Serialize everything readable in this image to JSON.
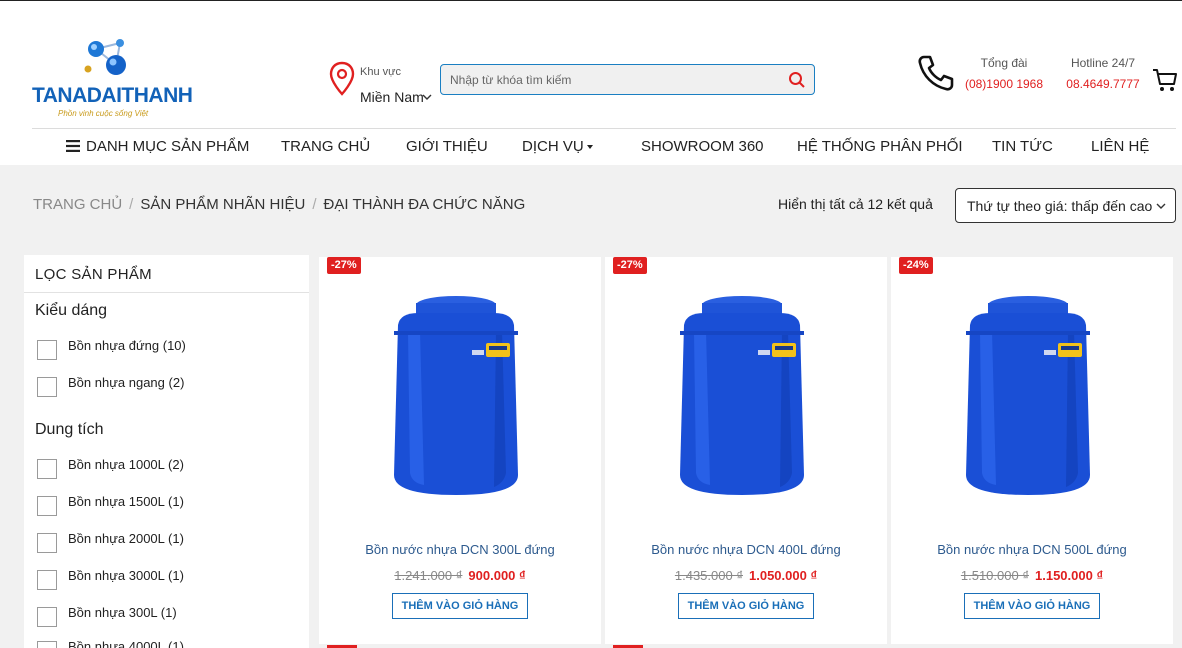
{
  "brand": {
    "name": "TANADAITHANH",
    "slogan": "Phồn vinh cuộc sống Việt",
    "blue": "#1262b8",
    "gold": "#c89a1a"
  },
  "region": {
    "label": "Khu vực",
    "value": "Miền Nam"
  },
  "search": {
    "placeholder": "Nhập từ khóa tìm kiếm"
  },
  "contacts": [
    {
      "label": "Tổng đài",
      "value": "(08)1900 1968"
    },
    {
      "label": "Hotline 24/7",
      "value": "08.4649.7777"
    }
  ],
  "nav": {
    "items": [
      "DANH MỤC SẢN PHẨM",
      "TRANG CHỦ",
      "GIỚI THIỆU",
      "DỊCH VỤ",
      "SHOWROOM 360",
      "HỆ THỐNG PHÂN PHỐI",
      "TIN TỨC",
      "LIÊN HỆ"
    ]
  },
  "breadcrumb": [
    "TRANG CHỦ",
    "SẢN PHẨM NHÃN HIỆU",
    "ĐẠI THÀNH ĐA CHỨC NĂNG"
  ],
  "results": {
    "count_text": "Hiển thị tất cả 12 kết quả",
    "sort_value": "Thứ tự theo giá: thấp đến cao"
  },
  "filters": {
    "title": "LỌC SẢN PHẨM",
    "groups": [
      {
        "heading": "Kiểu dáng",
        "options": [
          "Bồn nhựa đứng (10)",
          "Bồn nhựa ngang (2)"
        ]
      },
      {
        "heading": "Dung tích",
        "options": [
          "Bồn nhựa 1000L (2)",
          "Bồn nhựa 1500L (1)",
          "Bồn nhựa 2000L (1)",
          "Bồn nhựa 3000L (1)",
          "Bồn nhựa 300L (1)",
          "Bồn nhựa 4000L (1)"
        ]
      }
    ]
  },
  "products": [
    {
      "badge": "-27%",
      "name": "Bồn nước nhựa DCN 300L đứng",
      "old_price": "1.241.000 ₫",
      "new_price": "900.000 ₫",
      "button": "THÊM VÀO GIỎ HÀNG"
    },
    {
      "badge": "-27%",
      "name": "Bồn nước nhựa DCN 400L đứng",
      "old_price": "1.435.000 ₫",
      "new_price": "1.050.000 ₫",
      "button": "THÊM VÀO GIỎ HÀNG"
    },
    {
      "badge": "-24%",
      "name": "Bồn nước nhựa DCN 500L đứng",
      "old_price": "1.510.000 ₫",
      "new_price": "1.150.000 ₫",
      "button": "THÊM VÀO GIỎ HÀNG"
    }
  ],
  "colors": {
    "accent_red": "#e02020",
    "link_blue": "#2d5a8e",
    "tank_blue": "#1a4fd6"
  }
}
